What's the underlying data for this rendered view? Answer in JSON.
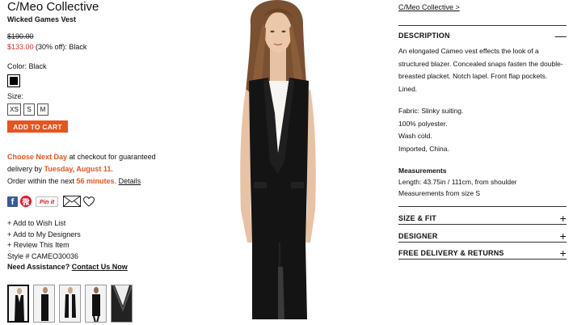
{
  "product": {
    "brand": "C/Meo Collective",
    "name": "Wicked Games Vest",
    "original_price": "$190.00",
    "sale_price": "$133.00",
    "discount_text": " (30% off): Black",
    "color_label": "Color: Black",
    "size_label": "Size:",
    "sizes": [
      "XS",
      "S",
      "M"
    ],
    "add_to_cart": "ADD TO CART",
    "style": "Style # CAMEO30036"
  },
  "shipping": {
    "cta": "Choose Next Day",
    "text1": " at checkout for guaranteed",
    "text2": "delivery by ",
    "date": "Tuesday, August 11",
    "text2_end": ".",
    "text3": "Order within the next ",
    "minutes": "56 minutes",
    "text3_end": ". ",
    "details": "Details"
  },
  "actions": {
    "wish": "+ Add to Wish List",
    "designers": "+ Add to My Designers",
    "review": "+ Review This Item",
    "assist": "Need Assistance? ",
    "contact": "Contact Us Now"
  },
  "social": {
    "fb": "f",
    "weibo": "微",
    "pin": "Pin it"
  },
  "breadcrumb": "C/Meo Collective >",
  "description": {
    "title": "DESCRIPTION",
    "sign": "—",
    "body": "An elongated Cameo vest effects the look of a structured blazer. Concealed snaps fasten the double-breasted placket. Notch lapel. Front flap pockets. Lined.",
    "fabric": [
      "Fabric: Slinky suiting.",
      "100% polyester.",
      "Wash cold.",
      "Imported, China."
    ],
    "measurements_title": "Measurements",
    "measurements": [
      "Length: 43.75in / 111cm, from shoulder",
      "Measurements from size S"
    ]
  },
  "accordion": [
    {
      "title": "SIZE & FIT",
      "sign": "+"
    },
    {
      "title": "DESIGNER",
      "sign": "+"
    },
    {
      "title": "FREE DELIVERY & RETURNS",
      "sign": "+"
    }
  ],
  "colors": {
    "accent": "#e8531e",
    "sale": "#d0302a"
  }
}
